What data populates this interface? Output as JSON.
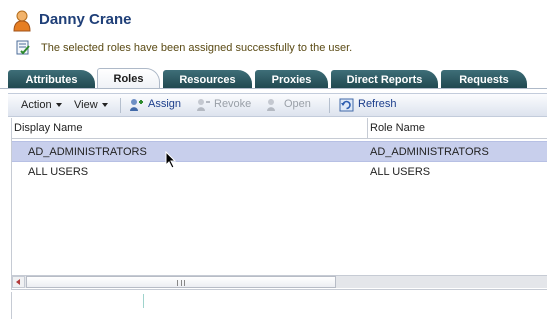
{
  "header": {
    "title": "Danny Crane",
    "icon": "user-icon"
  },
  "message": {
    "text": "The selected roles have been assigned successfully to the user.",
    "icon": "checklist-icon"
  },
  "tabs": [
    {
      "label": "Attributes",
      "active": false
    },
    {
      "label": "Roles",
      "active": true
    },
    {
      "label": "Resources",
      "active": false
    },
    {
      "label": "Proxies",
      "active": false
    },
    {
      "label": "Direct Reports",
      "active": false
    },
    {
      "label": "Requests",
      "active": false
    }
  ],
  "toolbar": {
    "action_label": "Action",
    "view_label": "View",
    "assign_label": "Assign",
    "revoke_label": "Revoke",
    "open_label": "Open",
    "refresh_label": "Refresh"
  },
  "table": {
    "columns": [
      "Display Name",
      "Role Name"
    ],
    "rows": [
      {
        "display_name": "AD_ADMINISTRATORS",
        "role_name": "AD_ADMINISTRATORS",
        "selected": true
      },
      {
        "display_name": "ALL USERS",
        "role_name": "ALL USERS",
        "selected": false
      }
    ]
  },
  "colors": {
    "tab": "#2f5c64",
    "title": "#1f3f78",
    "selected_row": "#c8cfec",
    "toolbar_link": "#1c3e8c"
  }
}
